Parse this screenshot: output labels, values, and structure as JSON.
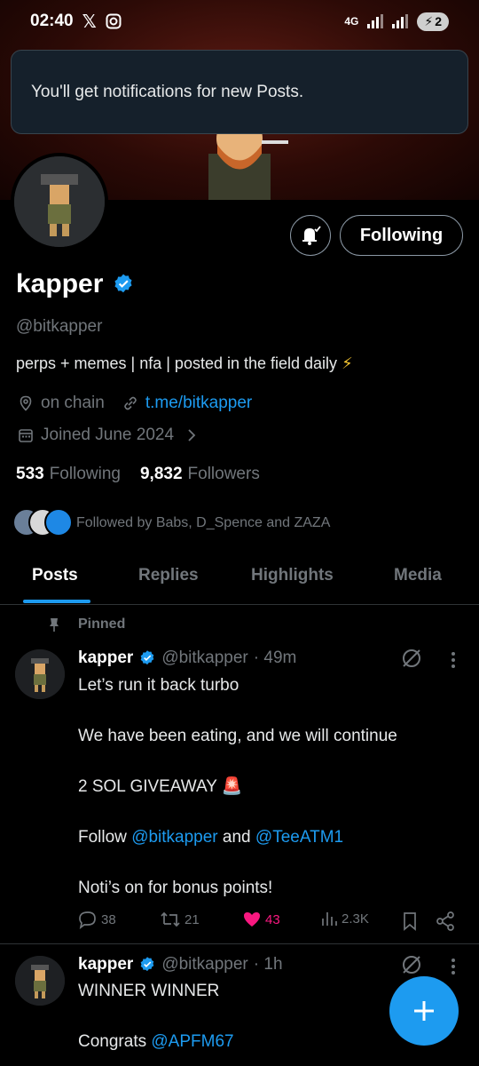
{
  "status": {
    "time": "02:40",
    "network": "4G",
    "battery": "2"
  },
  "toast": {
    "text": "You'll get notifications for new Posts."
  },
  "profile": {
    "following_label": "Following",
    "name": "kapper",
    "handle": "@bitkapper",
    "bio": "perps + memes | nfa | posted in the field daily",
    "bio_emoji": "⚡",
    "location": "on chain",
    "website": "t.me/bitkapper",
    "joined": "Joined June 2024",
    "following_count": "533",
    "following_text": "Following",
    "followers_count": "9,832",
    "followers_text": "Followers",
    "followed_by": "Followed by Babs, D_Spence and ZAZA"
  },
  "tabs": [
    {
      "label": "Posts",
      "active": true
    },
    {
      "label": "Replies",
      "active": false
    },
    {
      "label": "Highlights",
      "active": false
    },
    {
      "label": "Media",
      "active": false
    }
  ],
  "posts": [
    {
      "pinned_label": "Pinned",
      "name": "kapper",
      "handle": "@bitkapper",
      "time": "· 49m",
      "line1": "Let’s run it back turbo",
      "line2": "We have been eating, and we will continue",
      "line3": "2 SOL GIVEAWAY",
      "line3_emoji": "🚨",
      "line4_prefix": "Follow",
      "line4_mention1": "@bitkapper",
      "line4_and": "and",
      "line4_mention2": "@TeeATM1",
      "line5": "Noti’s on for bonus points!",
      "replies": "38",
      "reposts": "21",
      "likes": "43",
      "views": "2.3K"
    },
    {
      "name": "kapper",
      "handle": "@bitkapper",
      "time": "· 1h",
      "line1": "WINNER WINNER",
      "line2_prefix": "Congrats",
      "line2_mention": "@APFM67"
    }
  ],
  "colors": {
    "accent": "#1d9bf0",
    "like": "#f91880",
    "muted": "#71767b",
    "background": "#000000"
  }
}
